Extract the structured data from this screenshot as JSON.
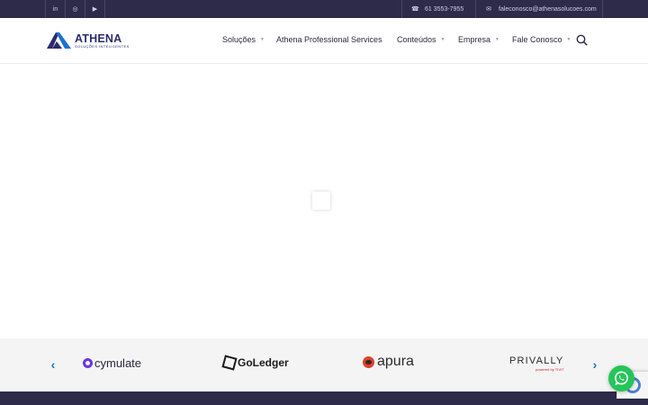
{
  "topbar": {
    "social": [
      {
        "icon": "linkedin-icon",
        "glyph": "in"
      },
      {
        "icon": "instagram-icon",
        "glyph": "◎"
      },
      {
        "icon": "youtube-icon",
        "glyph": "▶"
      }
    ],
    "phone": "61 3553-7955",
    "email": "faleconosco@athenasolucoes.com"
  },
  "logo": {
    "name": "ATHENA",
    "tagline": "SOLUÇÕES INTELIGENTES"
  },
  "nav": {
    "items": [
      {
        "label": "Soluções",
        "has_dropdown": true
      },
      {
        "label": "Athena Professional Services",
        "has_dropdown": false
      },
      {
        "label": "Conteúdos",
        "has_dropdown": true
      },
      {
        "label": "Empresa",
        "has_dropdown": true
      },
      {
        "label": "Fale Conosco",
        "has_dropdown": true
      }
    ]
  },
  "carousel": {
    "prev_glyph": "‹",
    "next_glyph": "›",
    "brands": [
      {
        "name": "cymulate"
      },
      {
        "name": "GoLedger"
      },
      {
        "name": "apura"
      },
      {
        "name": "PRIVALLY",
        "sub": "powered by TIVIT"
      }
    ]
  },
  "colors": {
    "topbar_bg": "#2d2a4a",
    "brand_navy": "#2b2c6b",
    "brand_blue": "#1e6fd0",
    "whatsapp_green": "#25c55a"
  }
}
